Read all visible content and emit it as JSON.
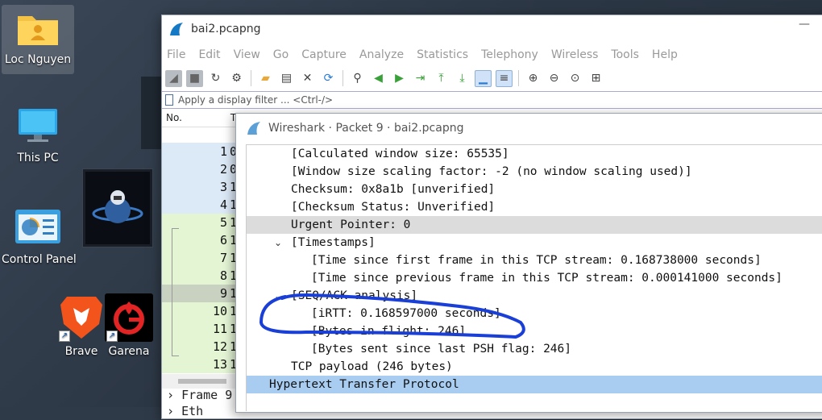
{
  "desktop": {
    "icons": [
      {
        "label": "Loc Nguyen"
      },
      {
        "label": "This PC"
      },
      {
        "label": "Control Panel"
      },
      {
        "label": "Brave"
      },
      {
        "label": "Garena"
      }
    ]
  },
  "main_window": {
    "title": "bai2.pcapng",
    "menu": [
      "File",
      "Edit",
      "View",
      "Go",
      "Capture",
      "Analyze",
      "Statistics",
      "Telephony",
      "Wireless",
      "Tools",
      "Help"
    ],
    "filter_placeholder": "Apply a display filter ... <Ctrl-/>",
    "columns": {
      "no": "No.",
      "time": "T"
    },
    "packet_rows": [
      {
        "num": "1",
        "time": "0"
      },
      {
        "num": "2",
        "time": "0"
      },
      {
        "num": "3",
        "time": "1"
      },
      {
        "num": "4",
        "time": "1"
      },
      {
        "num": "5",
        "time": "1"
      },
      {
        "num": "6",
        "time": "1"
      },
      {
        "num": "7",
        "time": "1"
      },
      {
        "num": "8",
        "time": "1"
      },
      {
        "num": "9",
        "time": "1"
      },
      {
        "num": "10",
        "time": "1"
      },
      {
        "num": "11",
        "time": "1"
      },
      {
        "num": "12",
        "time": "1"
      },
      {
        "num": "13",
        "time": "1"
      }
    ],
    "detail_tree": [
      "Frame 9",
      "Eth"
    ]
  },
  "packet_window": {
    "title": "Wireshark · Packet 9 · bai2.pcapng",
    "lines": [
      {
        "text": "[Calculated window size: 65535]"
      },
      {
        "text": "[Window size scaling factor: -2 (no window scaling used)]"
      },
      {
        "text": "Checksum: 0x8a1b [unverified]"
      },
      {
        "text": "[Checksum Status: Unverified]"
      },
      {
        "text": "Urgent Pointer: 0"
      },
      {
        "text": "[Timestamps]"
      },
      {
        "text": "[Time since first frame in this TCP stream: 0.168738000 seconds]"
      },
      {
        "text": "[Time since previous frame in this TCP stream: 0.000141000 seconds]"
      },
      {
        "text": "[SEQ/ACK analysis]"
      },
      {
        "text": "[iRTT: 0.168597000 seconds]"
      },
      {
        "text": "[Bytes in flight: 246]"
      },
      {
        "text": "[Bytes sent since last PSH flag: 246]"
      },
      {
        "text": "TCP payload (246 bytes)"
      },
      {
        "text": "Hypertext Transfer Protocol"
      }
    ]
  },
  "colors": {
    "selected_row": "#a9ccf1",
    "annotation": "#1a3fd6"
  }
}
